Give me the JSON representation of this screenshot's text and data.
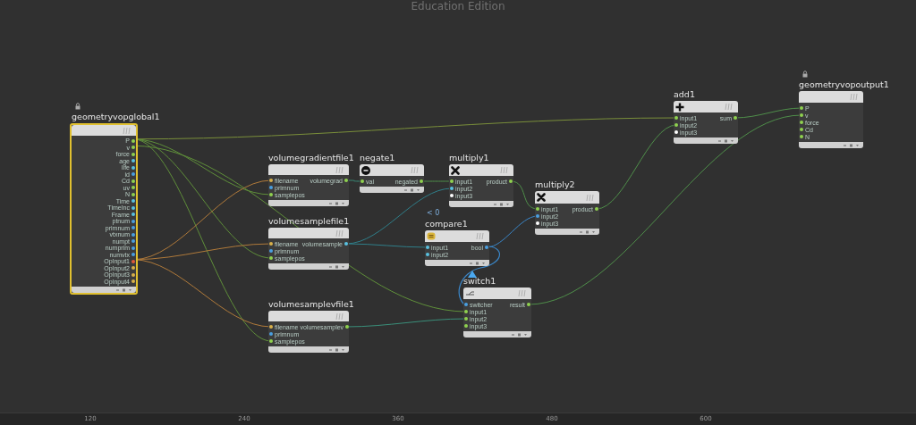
{
  "watermark_title": "Education Edition",
  "nodes": [
    {
      "name": "geometryvopglobal1",
      "selected": true,
      "locked": true,
      "outputs": [
        {
          "label": "P",
          "color": "#8fd14f"
        },
        {
          "label": "v",
          "color": "#8fd14f"
        },
        {
          "label": "force",
          "color": "#8fd14f"
        },
        {
          "label": "age",
          "color": "#59c1e0"
        },
        {
          "label": "life",
          "color": "#59c1e0"
        },
        {
          "label": "id",
          "color": "#4a9fe0"
        },
        {
          "label": "Cd",
          "color": "#8fd14f"
        },
        {
          "label": "uv",
          "color": "#8fd14f"
        },
        {
          "label": "N",
          "color": "#8fd14f"
        },
        {
          "label": "Time",
          "color": "#59c1e0"
        },
        {
          "label": "TimeInc",
          "color": "#59c1e0"
        },
        {
          "label": "Frame",
          "color": "#59c1e0"
        },
        {
          "label": "ptnum",
          "color": "#4a9fe0"
        },
        {
          "label": "primnum",
          "color": "#4a9fe0"
        },
        {
          "label": "vtxnum",
          "color": "#4a9fe0"
        },
        {
          "label": "numpt",
          "color": "#4a9fe0"
        },
        {
          "label": "numprim",
          "color": "#4a9fe0"
        },
        {
          "label": "numvtx",
          "color": "#4a9fe0"
        },
        {
          "label": "OpInput1",
          "color": "#e05a3a"
        },
        {
          "label": "OpInput2",
          "color": "#d8b04a"
        },
        {
          "label": "OpInput3",
          "color": "#d8b04a"
        },
        {
          "label": "OpInput4",
          "color": "#d8b04a"
        }
      ]
    },
    {
      "name": "volumegradientfile1",
      "selected": false,
      "locked": false,
      "inputs": [
        {
          "label": "filename",
          "color": "#d8b04a"
        },
        {
          "label": "primnum",
          "color": "#4a9fe0"
        },
        {
          "label": "samplepos",
          "color": "#8fd14f"
        }
      ],
      "outputs": [
        {
          "label": "volumegrad",
          "color": "#8fd14f"
        }
      ]
    },
    {
      "name": "volumesamplefile1",
      "selected": false,
      "locked": false,
      "inputs": [
        {
          "label": "filename",
          "color": "#d8b04a"
        },
        {
          "label": "primnum",
          "color": "#4a9fe0"
        },
        {
          "label": "samplepos",
          "color": "#8fd14f"
        }
      ],
      "outputs": [
        {
          "label": "volumesample",
          "color": "#59c1e0"
        }
      ]
    },
    {
      "name": "volumesamplevfile1",
      "selected": false,
      "locked": false,
      "inputs": [
        {
          "label": "filename",
          "color": "#d8b04a"
        },
        {
          "label": "primnum",
          "color": "#4a9fe0"
        },
        {
          "label": "samplepos",
          "color": "#8fd14f"
        }
      ],
      "outputs": [
        {
          "label": "volumesamplev",
          "color": "#8fd14f"
        }
      ]
    },
    {
      "name": "negate1",
      "selected": false,
      "locked": false,
      "inputs": [
        {
          "label": "val",
          "color": "#8fd14f"
        }
      ],
      "outputs": [
        {
          "label": "negated",
          "color": "#8fd14f"
        }
      ]
    },
    {
      "name": "compare1",
      "comment": "< 0",
      "selected": false,
      "locked": false,
      "inputs": [
        {
          "label": "input1",
          "color": "#59c1e0"
        },
        {
          "label": "input2",
          "color": "#59c1e0"
        }
      ],
      "outputs": [
        {
          "label": "bool",
          "color": "#4a9fe0"
        }
      ]
    },
    {
      "name": "multiply1",
      "selected": false,
      "locked": false,
      "inputs": [
        {
          "label": "input1",
          "color": "#8fd14f"
        },
        {
          "label": "input2",
          "color": "#59c1e0"
        },
        {
          "label": "input3",
          "color": "#ffffff"
        }
      ],
      "outputs": [
        {
          "label": "product",
          "color": "#8fd14f"
        }
      ]
    },
    {
      "name": "switch1",
      "selected": false,
      "locked": false,
      "inputs": [
        {
          "label": "switcher",
          "color": "#4a9fe0"
        },
        {
          "label": "input1",
          "color": "#8fd14f"
        },
        {
          "label": "input2",
          "color": "#8fd14f"
        },
        {
          "label": "input3",
          "color": "#8fd14f"
        }
      ],
      "outputs": [
        {
          "label": "result",
          "color": "#8fd14f"
        }
      ]
    },
    {
      "name": "multiply2",
      "selected": false,
      "locked": false,
      "inputs": [
        {
          "label": "input1",
          "color": "#8fd14f"
        },
        {
          "label": "input2",
          "color": "#4a9fe0"
        },
        {
          "label": "input3",
          "color": "#ffffff"
        }
      ],
      "outputs": [
        {
          "label": "product",
          "color": "#8fd14f"
        }
      ]
    },
    {
      "name": "add1",
      "selected": false,
      "locked": false,
      "inputs": [
        {
          "label": "input1",
          "color": "#8fd14f"
        },
        {
          "label": "input2",
          "color": "#8fd14f"
        },
        {
          "label": "input3",
          "color": "#ffffff"
        }
      ],
      "outputs": [
        {
          "label": "sum",
          "color": "#8fd14f"
        }
      ]
    },
    {
      "name": "geometryvopoutput1",
      "selected": false,
      "locked": true,
      "inputs": [
        {
          "label": "P",
          "color": "#8fd14f"
        },
        {
          "label": "v",
          "color": "#8fd14f"
        },
        {
          "label": "force",
          "color": "#8fd14f"
        },
        {
          "label": "Cd",
          "color": "#8fd14f"
        },
        {
          "label": "N",
          "color": "#8fd14f"
        }
      ]
    }
  ],
  "ruler": [
    "120",
    "240",
    "360",
    "480",
    "600"
  ]
}
